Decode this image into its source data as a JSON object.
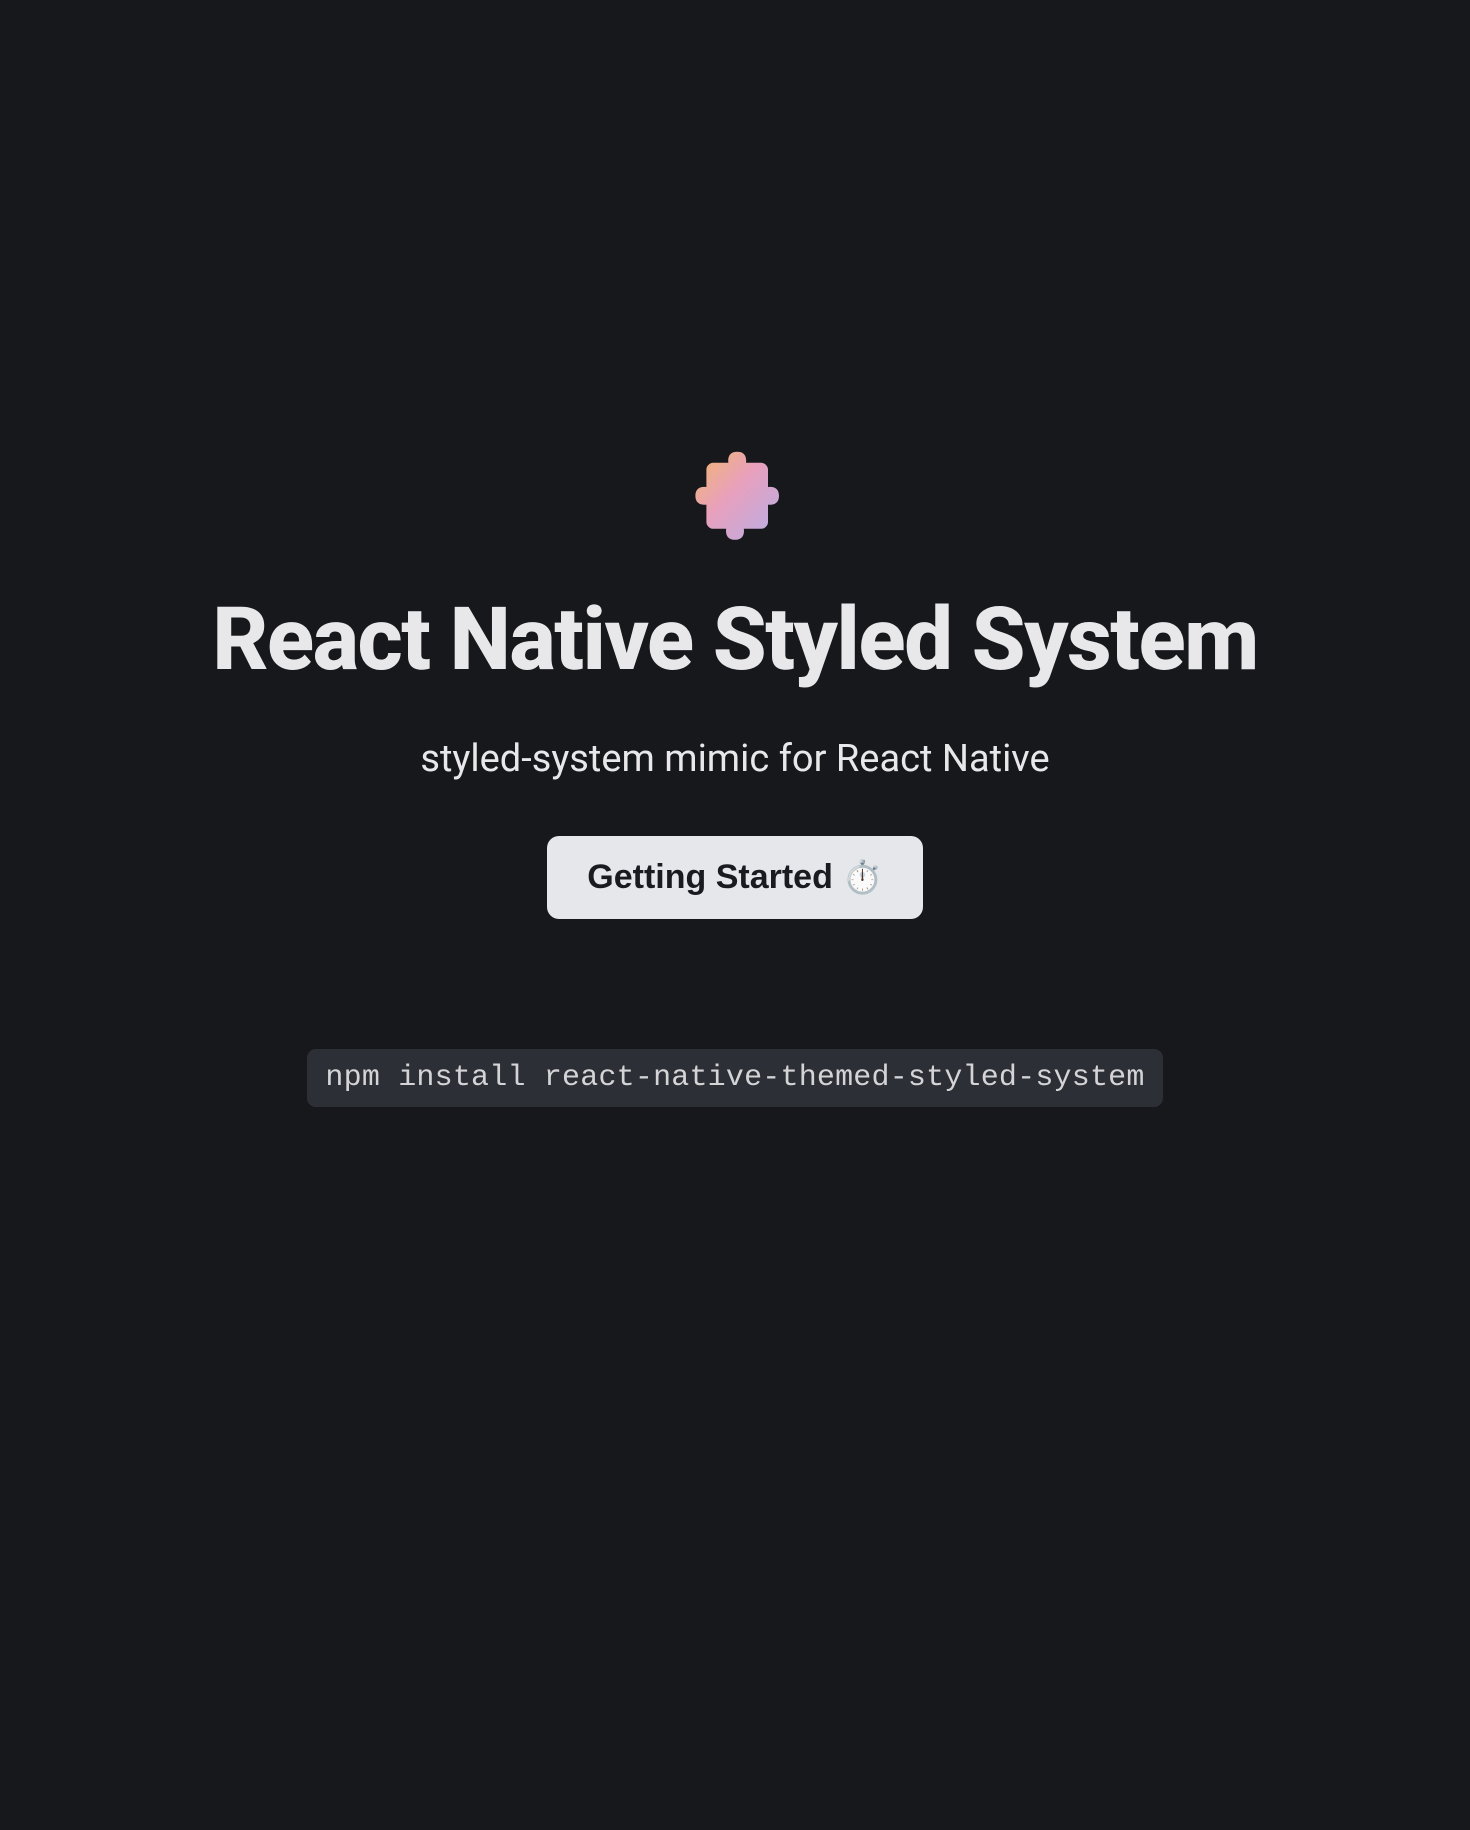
{
  "hero": {
    "title": "React Native Styled System",
    "subtitle": "styled-system mimic for React Native",
    "cta_label": "Getting Started",
    "cta_icon": "⏱️",
    "install_command": "npm install react-native-themed-styled-system"
  },
  "logo": {
    "name": "puzzle-piece-icon",
    "gradient_start": "#f2b76b",
    "gradient_mid": "#e8a0bd",
    "gradient_end": "#b6aee8"
  },
  "colors": {
    "background": "#17181c",
    "text_primary": "#e8e8ea",
    "button_bg": "#e6e7ea",
    "button_text": "#1a1b20",
    "code_bg": "#2d2f36",
    "code_text": "#d4d4d7"
  }
}
